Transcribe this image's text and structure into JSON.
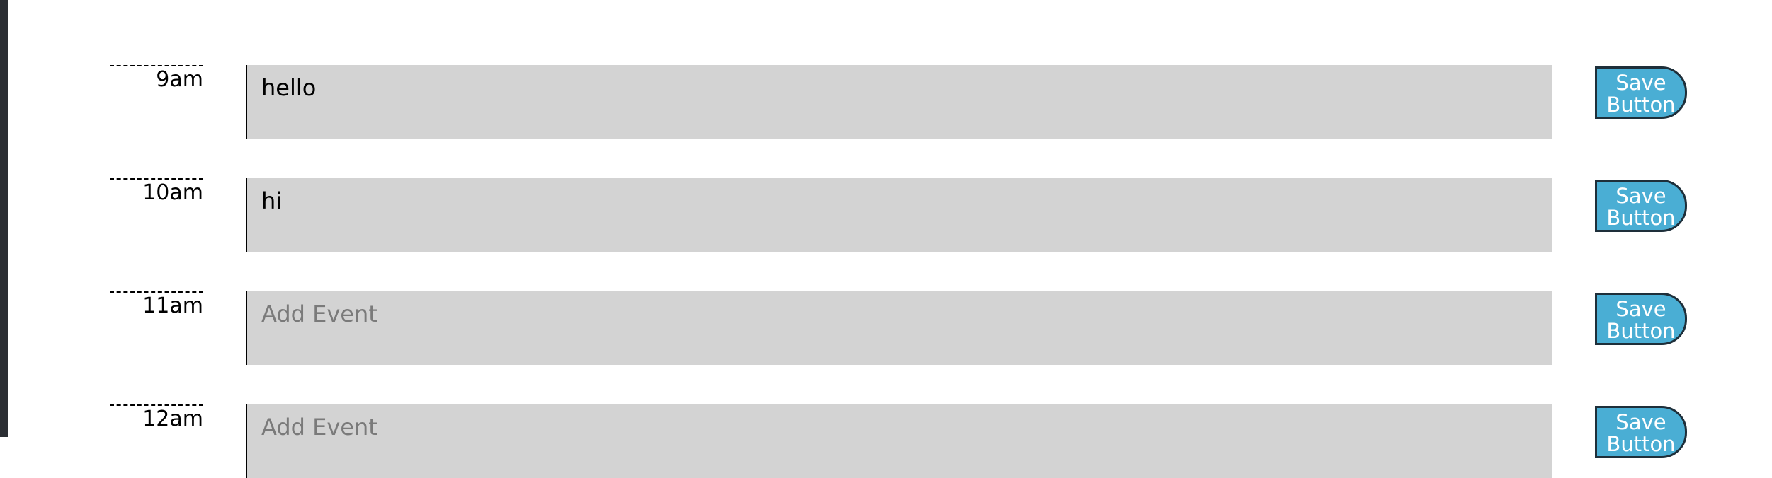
{
  "rows": [
    {
      "hour": "9am",
      "value": "hello",
      "placeholder": "Add Event",
      "save_line1": "Save",
      "save_line2": "Button"
    },
    {
      "hour": "10am",
      "value": "hi",
      "placeholder": "Add Event",
      "save_line1": "Save",
      "save_line2": "Button"
    },
    {
      "hour": "11am",
      "value": "",
      "placeholder": "Add Event",
      "save_line1": "Save",
      "save_line2": "Button"
    },
    {
      "hour": "12am",
      "value": "",
      "placeholder": "Add Event",
      "save_line1": "Save",
      "save_line2": "Button"
    }
  ],
  "colors": {
    "event_background": "#d3d3d3",
    "save_button": "#4aaed4",
    "save_button_border": "#1e2f3a"
  }
}
